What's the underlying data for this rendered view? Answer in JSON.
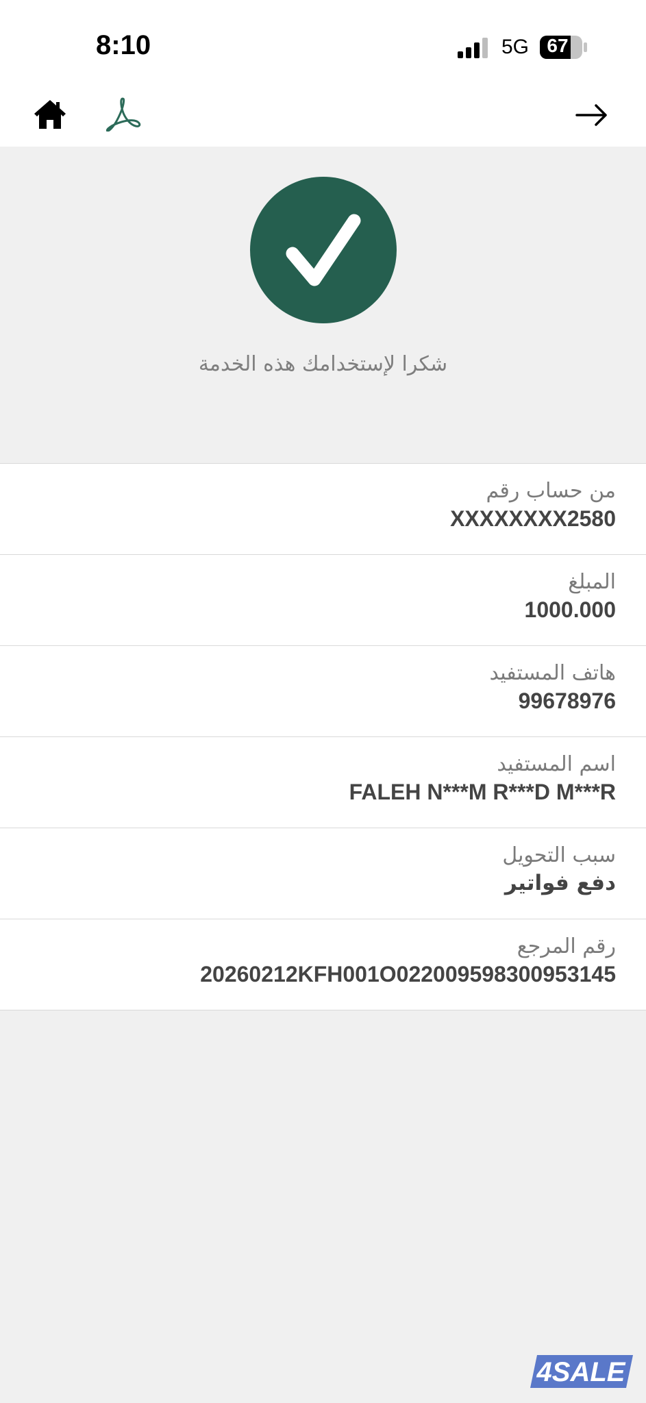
{
  "status_bar": {
    "time": "8:10",
    "network": "5G",
    "battery": "67"
  },
  "nav": {
    "home_icon": "home-icon",
    "pdf_icon": "pdf-icon",
    "back_icon": "arrow-right-icon"
  },
  "confirmation": {
    "icon": "check-icon",
    "message": "شكرا لإستخدامك هذه الخدمة",
    "accent_color": "#255f4f"
  },
  "details": [
    {
      "label": "من حساب رقم",
      "value": "XXXXXXXX2580"
    },
    {
      "label": "المبلغ",
      "value": "1000.000"
    },
    {
      "label": "هاتف المستفيد",
      "value": "99678976"
    },
    {
      "label": "اسم المستفيد",
      "value": "FALEH N***M R***D M***R"
    },
    {
      "label": "سبب التحويل",
      "value": "دفع فواتير"
    },
    {
      "label": "رقم المرجع",
      "value": "20260212KFH001O022009598300953145"
    }
  ],
  "watermark": "4SALE"
}
